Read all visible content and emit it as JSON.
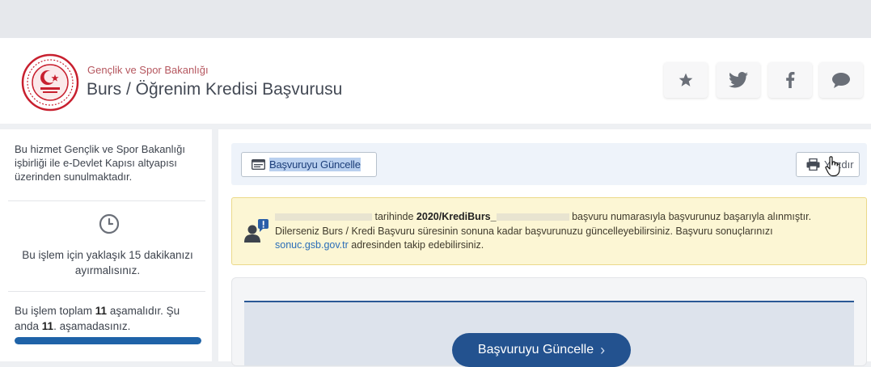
{
  "header": {
    "org_name": "Gençlik ve Spor Bakanlığı",
    "service_title": "Burs / Öğrenim Kredisi Başvurusu",
    "actions": [
      {
        "name": "favorite",
        "icon": "star-icon"
      },
      {
        "name": "twitter",
        "icon": "twitter-icon"
      },
      {
        "name": "facebook",
        "icon": "facebook-icon"
      },
      {
        "name": "feedback",
        "icon": "chat-icon"
      }
    ]
  },
  "sidebar": {
    "intro": "Bu hizmet Gençlik ve Spor Bakanlığı işbirliği ile e-Devlet Kapısı altyapısı üzerinden sunulmaktadır.",
    "time_note": "Bu işlem için yaklaşık 15 dakikanızı ayırmalısınız.",
    "steps_prefix": "Bu işlem toplam ",
    "steps_total": "11",
    "steps_middle": " aşamalıdır. Şu anda ",
    "steps_current": "11",
    "steps_suffix": ". aşamadasınız.",
    "progress_fraction": 1.0
  },
  "toolbar": {
    "update_label": "Başvuruyu Güncelle",
    "print_label": "Yazdır"
  },
  "notice": {
    "part1": "tarihinde ",
    "ref_prefix": "2020/KrediBurs_",
    "part2": " başvuru numarasıyla başvurunuz başarıyla alınmıştır.",
    "line2": "Dilerseniz Burs / Kredi Başvuru süresinin sonuna kadar başvurunuzu güncelleyebilirsiniz. Başvuru sonuçlarınızı",
    "link": "sonuc.gsb.gov.tr",
    "part3": " adresinden takip edebilirsiniz."
  },
  "main_action": {
    "label": "Başvuruyu Güncelle",
    "chevron": "›"
  },
  "colors": {
    "primary": "#23528f",
    "brand_red": "#c8202f",
    "notice_bg": "#fcf6d4"
  }
}
